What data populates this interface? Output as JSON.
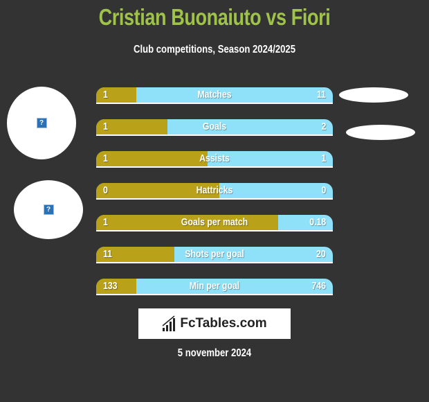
{
  "header": {
    "title": "Cristian Buonaiuto vs Fiori",
    "subtitle": "Club competitions, Season 2024/2025"
  },
  "players": [
    {
      "name": "Cristian Buonaiuto",
      "avatar_icon": "broken-image-icon"
    },
    {
      "name": "Fiori",
      "avatar_icon": "broken-image-icon"
    }
  ],
  "colors": {
    "left": "#b9a11a",
    "right": "#8fe1f9",
    "title": "#9fc24a",
    "background": "#333333"
  },
  "stats": [
    {
      "label": "Matches",
      "left": "1",
      "right": "11",
      "left_share": 0.17
    },
    {
      "label": "Goals",
      "left": "1",
      "right": "2",
      "left_share": 0.3
    },
    {
      "label": "Assists",
      "left": "1",
      "right": "1",
      "left_share": 0.47
    },
    {
      "label": "Hattricks",
      "left": "0",
      "right": "0",
      "left_share": 0.52
    },
    {
      "label": "Goals per match",
      "left": "1",
      "right": "0.18",
      "left_share": 0.77
    },
    {
      "label": "Shots per goal",
      "left": "11",
      "right": "20",
      "left_share": 0.33
    },
    {
      "label": "Min per goal",
      "left": "133",
      "right": "746",
      "left_share": 0.17
    }
  ],
  "footer": {
    "logo_text": "FcTables.com",
    "logo_icon": "bar-chart-icon",
    "date": "5 november 2024"
  }
}
